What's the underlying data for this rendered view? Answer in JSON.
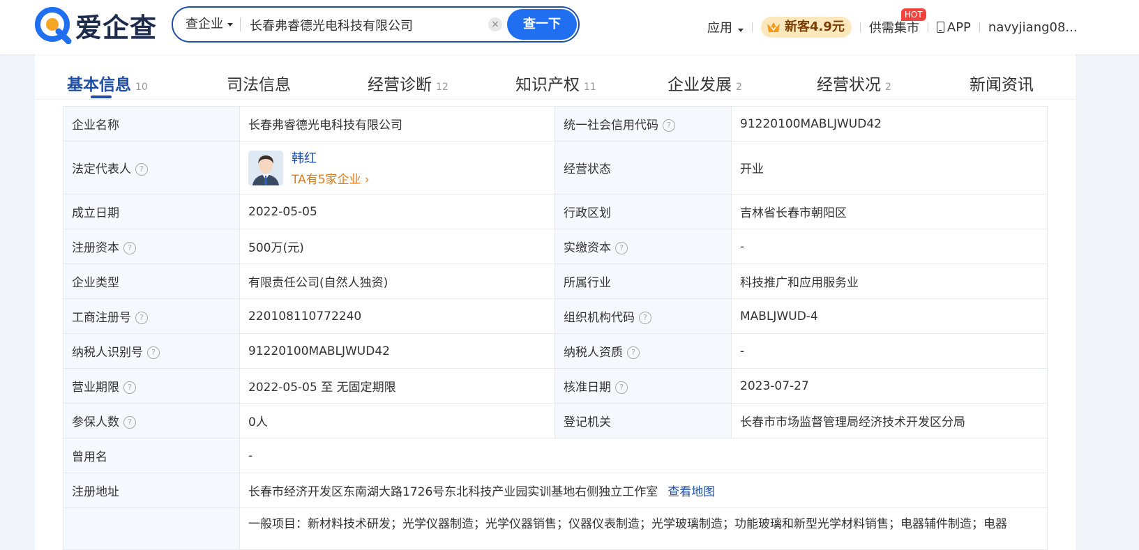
{
  "header": {
    "logo_text": "爱企查",
    "search_scope": "查企业",
    "search_value": "长春弗睿德光电科技有限公司",
    "search_clear": "×",
    "search_button": "查一下",
    "nav_apps": "应用",
    "vip_label": "新客4.9元",
    "market_label": "供需集市",
    "market_badge": "HOT",
    "app_label": "APP",
    "user_name": "navyjiang08..."
  },
  "tabs": [
    {
      "label": "基本信息",
      "count": "10"
    },
    {
      "label": "司法信息",
      "count": ""
    },
    {
      "label": "经营诊断",
      "count": "12"
    },
    {
      "label": "知识产权",
      "count": "11"
    },
    {
      "label": "企业发展",
      "count": "2"
    },
    {
      "label": "经营状况",
      "count": "2"
    },
    {
      "label": "新闻资讯",
      "count": ""
    }
  ],
  "info": {
    "company_name_label": "企业名称",
    "company_name": "长春弗睿德光电科技有限公司",
    "credit_code_label": "统一社会信用代码",
    "credit_code": "91220100MABLJWUD42",
    "legal_rep_label": "法定代表人",
    "legal_rep_name": "韩红",
    "legal_rep_link": "TA有5家企业",
    "status_label": "经营状态",
    "status": "开业",
    "founded_label": "成立日期",
    "founded": "2022-05-05",
    "region_label": "行政区划",
    "region": "吉林省长春市朝阳区",
    "reg_capital_label": "注册资本",
    "reg_capital": "500万(元)",
    "paid_capital_label": "实缴资本",
    "paid_capital": "-",
    "type_label": "企业类型",
    "type": "有限责任公司(自然人独资)",
    "industry_label": "所属行业",
    "industry": "科技推广和应用服务业",
    "reg_no_label": "工商注册号",
    "reg_no": "220108110772240",
    "org_code_label": "组织机构代码",
    "org_code": "MABLJWUD-4",
    "taxpayer_id_label": "纳税人识别号",
    "taxpayer_id": "91220100MABLJWUD42",
    "taxpayer_qual_label": "纳税人资质",
    "taxpayer_qual": "-",
    "term_label": "营业期限",
    "term": "2022-05-05 至 无固定期限",
    "approval_label": "核准日期",
    "approval": "2023-07-27",
    "insured_label": "参保人数",
    "insured": "0人",
    "authority_label": "登记机关",
    "authority": "长春市市场监督管理局经济技术开发区分局",
    "former_name_label": "曾用名",
    "former_name": "-",
    "address_label": "注册地址",
    "address": "长春市经济开发区东南湖大路1726号东北科技产业园实训基地右侧独立工作室",
    "map_link": "查看地图",
    "scope": "一般项目：新材料技术研发；光学仪器制造；光学仪器销售；仪器仪表制造；光学玻璃制造；功能玻璃和新型光学材料销售；电器辅件制造；电器"
  },
  "help_glyph": "?",
  "colors": {
    "brand": "#1f4fa8",
    "button": "#1f6ff0",
    "link_orange": "#e07b17",
    "hot": "#f2433c"
  }
}
